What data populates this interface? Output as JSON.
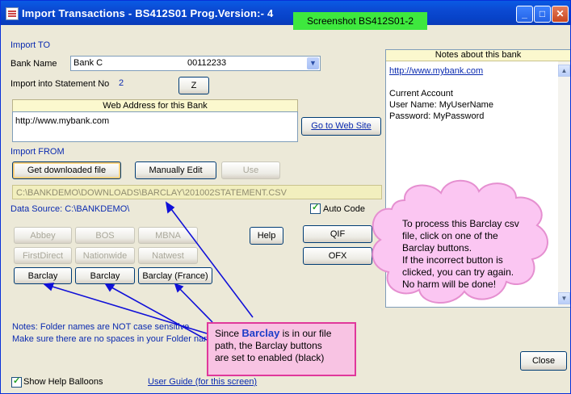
{
  "window": {
    "title": "Import Transactions  -  BS412S01   Prog.Version:-  4",
    "buttons": {
      "minimize": "_",
      "maximize": "□",
      "close": "✕"
    }
  },
  "screenshot_tag": "Screenshot BS412S01-2",
  "import_to": {
    "heading": "Import TO",
    "bank_label": "Bank Name",
    "bank_name": "Bank C",
    "bank_account": "00112233",
    "stmt_label": "Import into Statement No",
    "stmt_no": "2",
    "z_button": "Z"
  },
  "web": {
    "heading": "Web Address for this Bank",
    "url": "http://www.mybank.com",
    "go_button": "Go to Web Site"
  },
  "import_from": {
    "heading": "Import FROM",
    "get_button": "Get downloaded file",
    "manual_button": "Manually Edit",
    "use_button": "Use",
    "path": "C:\\BANKDEMO\\DOWNLOADS\\BARCLAY\\201002STATEMENT.CSV",
    "data_source": "Data Source: C:\\BANKDEMO\\",
    "auto_code_label": "Auto Code",
    "auto_code_checked": true
  },
  "bank_buttons": {
    "row1": [
      "Abbey",
      "BOS",
      "MBNA"
    ],
    "row2": [
      "FirstDirect",
      "Nationwide",
      "Natwest"
    ],
    "row3": [
      "Barclay",
      "Barclay",
      "Barclay (France)"
    ],
    "help": "Help",
    "qif": "QIF",
    "ofx": "OFX"
  },
  "notes_footer": {
    "line1": "Notes: Folder names are NOT case sensitive",
    "line2": "Make sure there are no spaces in your Folder nam"
  },
  "notes_panel": {
    "heading": "Notes about this bank",
    "link": "http://www.mybank.com",
    "lines": [
      "Current Account",
      "User Name: MyUserName",
      "Password:  MyPassword"
    ]
  },
  "bottom": {
    "show_balloons_label": "Show Help Balloons",
    "show_balloons_checked": true,
    "user_guide": "User Guide (for this screen)",
    "close_button": "Close"
  },
  "callout": {
    "prefix": "Since ",
    "bold": "Barclay",
    "rest1": " is in our file",
    "line2": "path, the Barclay buttons",
    "line3": "are set to enabled (black)"
  },
  "cloud": {
    "lines": [
      "To process this Barclay csv",
      "file, click on one of the",
      "Barclay buttons.",
      "If the incorrect button is",
      "clicked, you can try again.",
      "No harm will be done!"
    ]
  },
  "colors": {
    "titlebar": "#0b49d2",
    "tag_green": "#3ee83e",
    "callout_pink": "#f8c3e3",
    "cloud_pink": "#fbc6f2",
    "arrow_blue": "#1010d8"
  }
}
